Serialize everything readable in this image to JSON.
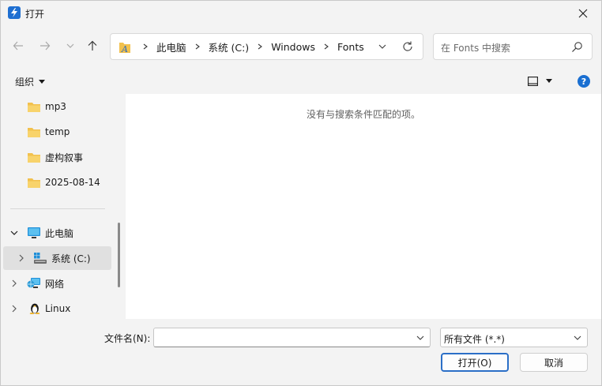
{
  "window": {
    "title": "打开"
  },
  "address": {
    "crumbs": [
      "此电脑",
      "系统 (C:)",
      "Windows",
      "Fonts"
    ]
  },
  "search": {
    "placeholder": "在 Fonts 中搜索"
  },
  "commandbar": {
    "organize_label": "组织"
  },
  "content": {
    "empty_message": "没有与搜索条件匹配的项。"
  },
  "navpane": {
    "quick_items": [
      {
        "label": "mp3"
      },
      {
        "label": "temp"
      },
      {
        "label": "虚构叙事"
      },
      {
        "label": "2025-08-14"
      }
    ],
    "tree_items": [
      {
        "label": "此电脑",
        "icon": "monitor-icon",
        "expanded": true
      },
      {
        "label": "系统 (C:)",
        "icon": "drive-icon",
        "selected": true
      },
      {
        "label": "网络",
        "icon": "network-icon"
      },
      {
        "label": "Linux",
        "icon": "linux-penguin-icon"
      }
    ]
  },
  "bottom": {
    "filename_label": "文件名(N):",
    "filename_value": "",
    "filter_value": "所有文件 (*.*)",
    "open_label": "打开(O)",
    "cancel_label": "取消"
  },
  "colors": {
    "accent": "#2b6fc7",
    "folder": "#f2c14e",
    "help": "#1a6fd1"
  }
}
